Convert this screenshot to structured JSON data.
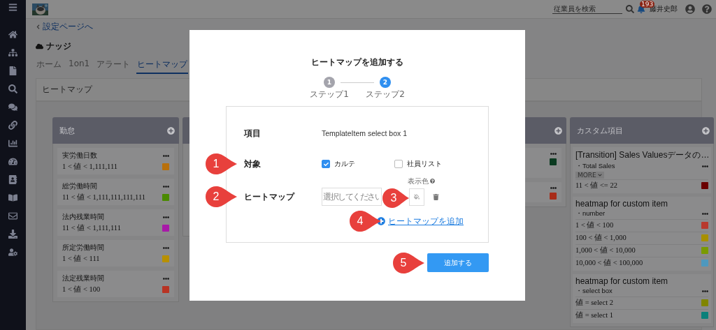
{
  "header": {
    "search": {
      "placeholder": "従業員を検索"
    },
    "notification_count": "193",
    "user_name": "藤井史郎"
  },
  "back_link": "設定ページへ",
  "page_title": "ナッジ",
  "tabs": [
    {
      "label": "ホーム",
      "selected": false
    },
    {
      "label": "1on1",
      "selected": false
    },
    {
      "label": "アラート",
      "selected": false
    },
    {
      "label": "ヒートマップ",
      "selected": true
    }
  ],
  "panel": {
    "title": "ヒートマップ",
    "columns": [
      {
        "kind": "full",
        "title": "勤怠",
        "items": [
          {
            "name": "実労働日数",
            "range": "1 < 値 < 1,111,111",
            "color": "#b8700c"
          },
          {
            "name": "総労働時間",
            "range": "11 < 値 < 1,111,111,111,111",
            "color": "#4a8a00"
          },
          {
            "name": "法内残業時間",
            "range": "11 < 値 < 1,111,111",
            "color": "#a81aa8"
          },
          {
            "name": "所定労働時間",
            "range": "1 < 値 < 111",
            "color": "#b89000"
          },
          {
            "name": "法定残業時間",
            "range": "1 < 値 < 100",
            "color": "#b83424"
          }
        ]
      },
      {
        "kind": "covered"
      },
      {
        "kind": "partial",
        "items": [
          {
            "color": "#0a3a20"
          },
          {
            "color": "#a82c18"
          }
        ]
      },
      {
        "kind": "custom",
        "title": "カスタム項目",
        "groups": [
          {
            "name": "[Transition] Sales Valuesデータの…",
            "sub": "・Total Sales",
            "more": "MORE",
            "ranges": [
              {
                "range": "11 < 値 <= 22",
                "color": "#6a0000"
              }
            ]
          },
          {
            "name": "heatmap for custom item",
            "sub": "・number",
            "ranges": [
              {
                "range": "1 < 値 < 100",
                "color": "#b83a2e"
              },
              {
                "range": "100 < 値 < 1,000",
                "color": "#a89000"
              },
              {
                "range": "1,000 < 値 < 10,000",
                "color": "#7a9a00"
              },
              {
                "range": "10,000 < 値 < 100,000",
                "color": "#4e98be"
              }
            ]
          },
          {
            "name": "heatmap for custom item",
            "sub": "・select box",
            "ranges": [
              {
                "range": "値 = select 2",
                "color": "#808500"
              },
              {
                "range": "値 = select 1",
                "color": "#0a807a"
              }
            ]
          }
        ]
      }
    ]
  },
  "modal": {
    "title": "ヒートマップを追加する",
    "steps": [
      {
        "number": "1",
        "label": "ステップ1",
        "selected": false
      },
      {
        "number": "2",
        "label": "ステップ2",
        "selected": true
      }
    ],
    "item": {
      "label": "項目",
      "value": "TemplateItem select box 1"
    },
    "target": {
      "label": "対象",
      "callout": "1",
      "options": [
        {
          "label": "カルテ",
          "checked": true
        },
        {
          "label": "社員リスト",
          "checked": false
        }
      ]
    },
    "heatmap": {
      "label": "ヒートマップ",
      "callout": "2",
      "select": {
        "placeholder": "選択してください"
      },
      "color_label": "表示色",
      "color_callout": "3"
    },
    "add_link": {
      "label": "ヒートマップを追加",
      "callout": "4"
    },
    "submit": {
      "label": "追加する",
      "callout": "5"
    }
  }
}
